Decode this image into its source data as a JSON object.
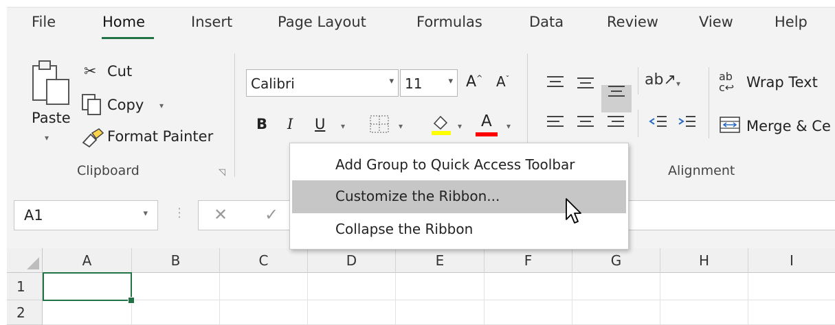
{
  "tabs": [
    {
      "label": "File"
    },
    {
      "label": "Home"
    },
    {
      "label": "Insert"
    },
    {
      "label": "Page Layout"
    },
    {
      "label": "Formulas"
    },
    {
      "label": "Data"
    },
    {
      "label": "Review"
    },
    {
      "label": "View"
    },
    {
      "label": "Help"
    }
  ],
  "clipboard": {
    "paste_label": "Paste",
    "cut_label": "Cut",
    "copy_label": "Copy",
    "format_painter_label": "Format Painter",
    "group_label": "Clipboard"
  },
  "font": {
    "name": "Calibri",
    "size": "11",
    "bold": "B",
    "italic": "I",
    "underline": "U",
    "grow": "A",
    "shrink": "A",
    "font_color_letter": "A",
    "font_color": "#ff0000",
    "highlight_color": "#ffff00"
  },
  "alignment": {
    "wrap_text_label": "Wrap Text",
    "merge_label": "Merge & Ce",
    "group_label": "Alignment"
  },
  "name_box": {
    "value": "A1"
  },
  "columns": [
    "A",
    "B",
    "C",
    "D",
    "E",
    "F",
    "G",
    "H",
    "I"
  ],
  "rows": [
    "1",
    "2"
  ],
  "context_menu": {
    "items": [
      {
        "label": "Add Group to Quick Access Toolbar"
      },
      {
        "label": "Customize the Ribbon..."
      },
      {
        "label": "Collapse the Ribbon"
      }
    ]
  },
  "colors": {
    "accent": "#217346",
    "ribbon_bg": "#f3f3f3",
    "menu_highlight": "#c6c6c6"
  }
}
